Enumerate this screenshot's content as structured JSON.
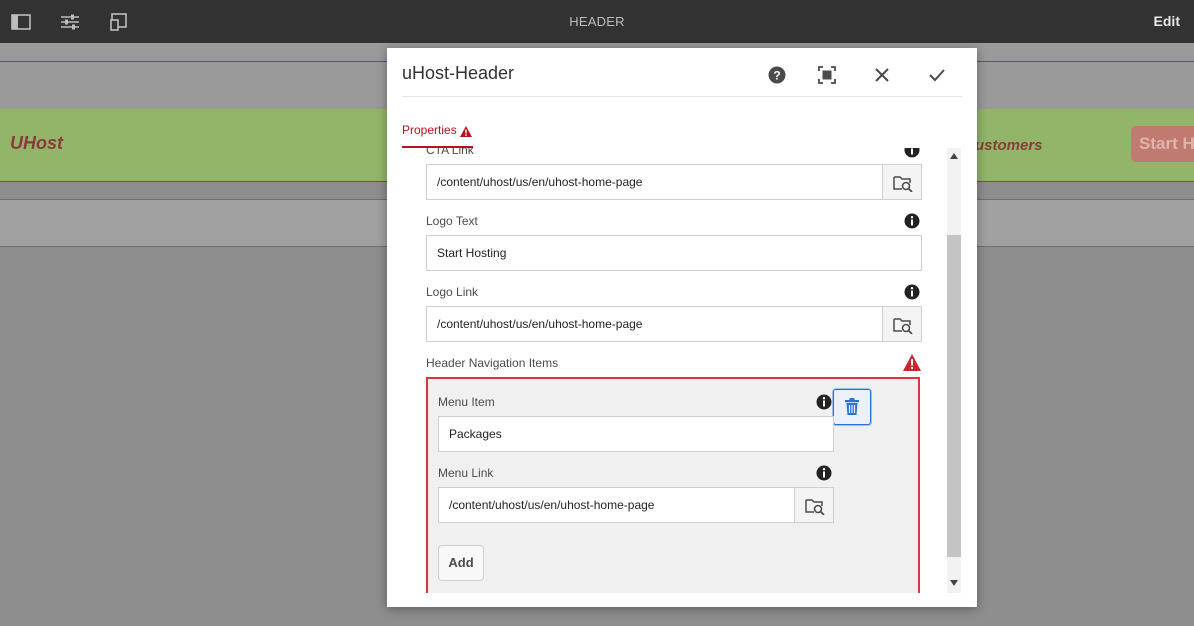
{
  "editor": {
    "title": "HEADER",
    "mode_label": "Edit",
    "icons": [
      "side-panel-icon",
      "properties-icon",
      "emulator-icon"
    ]
  },
  "background_page": {
    "brand": "UHost",
    "customers_text": "ustomers",
    "start_button": "Start H"
  },
  "dialog": {
    "title": "uHost-Header",
    "controls": [
      "help-icon",
      "fullscreen-icon",
      "close-icon",
      "confirm-icon"
    ],
    "tab": "Properties",
    "fields": {
      "cta_link": {
        "label": "CTA Link",
        "value": "/content/uhost/us/en/uhost-home-page"
      },
      "logo_text": {
        "label": "Logo Text",
        "value": "Start Hosting"
      },
      "logo_link": {
        "label": "Logo Link",
        "value": "/content/uhost/us/en/uhost-home-page"
      },
      "nav_items": {
        "label": "Header Navigation Items",
        "menu_item": {
          "label": "Menu Item",
          "value": "Packages"
        },
        "menu_link": {
          "label": "Menu Link",
          "value": "/content/uhost/us/en/uhost-home-page"
        },
        "add_label": "Add"
      }
    }
  },
  "colors": {
    "accent_red": "#b5141f",
    "error_red": "#d7373f",
    "focus_blue": "#2b71d8",
    "header_green": "#93b56a"
  }
}
